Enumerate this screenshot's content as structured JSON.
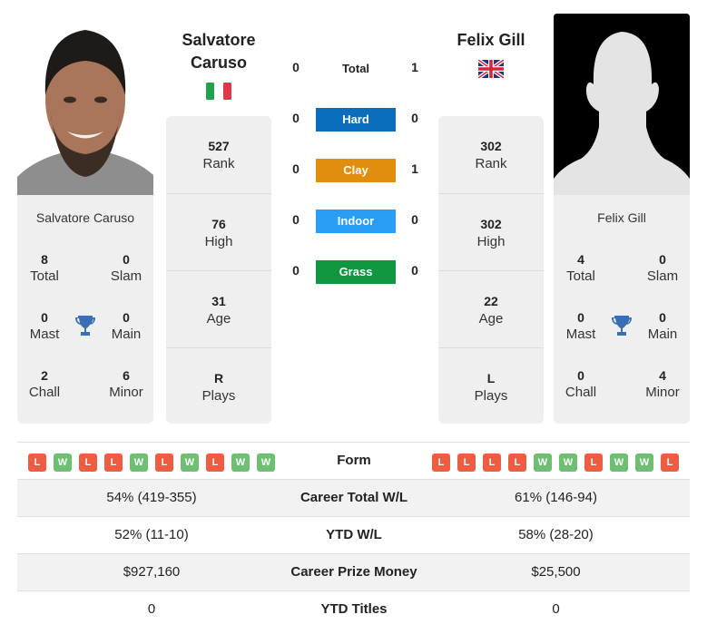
{
  "player1": {
    "name": "Salvatore Caruso",
    "name_line1": "Salvatore",
    "name_line2": "Caruso",
    "flag": "italy-flag",
    "card_name": "Salvatore Caruso",
    "titles": {
      "total": {
        "value": "8",
        "label": "Total"
      },
      "slam": {
        "value": "0",
        "label": "Slam"
      },
      "mast": {
        "value": "0",
        "label": "Mast"
      },
      "main": {
        "value": "0",
        "label": "Main"
      },
      "chall": {
        "value": "2",
        "label": "Chall"
      },
      "minor": {
        "value": "6",
        "label": "Minor"
      }
    },
    "info": [
      {
        "value": "527",
        "label": "Rank"
      },
      {
        "value": "76",
        "label": "High"
      },
      {
        "value": "31",
        "label": "Age"
      },
      {
        "value": "R",
        "label": "Plays"
      }
    ],
    "form": [
      "L",
      "W",
      "L",
      "L",
      "W",
      "L",
      "W",
      "L",
      "W",
      "W"
    ]
  },
  "player2": {
    "name": "Felix Gill",
    "flag": "uk-flag",
    "card_name": "Felix Gill",
    "titles": {
      "total": {
        "value": "4",
        "label": "Total"
      },
      "slam": {
        "value": "0",
        "label": "Slam"
      },
      "mast": {
        "value": "0",
        "label": "Mast"
      },
      "main": {
        "value": "0",
        "label": "Main"
      },
      "chall": {
        "value": "0",
        "label": "Chall"
      },
      "minor": {
        "value": "4",
        "label": "Minor"
      }
    },
    "info": [
      {
        "value": "302",
        "label": "Rank"
      },
      {
        "value": "302",
        "label": "High"
      },
      {
        "value": "22",
        "label": "Age"
      },
      {
        "value": "L",
        "label": "Plays"
      }
    ],
    "form": [
      "L",
      "L",
      "L",
      "L",
      "W",
      "W",
      "L",
      "W",
      "W",
      "L"
    ]
  },
  "h2h": {
    "total": {
      "label": "Total",
      "p1": "0",
      "p2": "1"
    },
    "surfaces": [
      {
        "label": "Hard",
        "p1": "0",
        "p2": "0",
        "color": "#0a6ebd"
      },
      {
        "label": "Clay",
        "p1": "0",
        "p2": "1",
        "color": "#e08e0b"
      },
      {
        "label": "Indoor",
        "p1": "0",
        "p2": "0",
        "color": "#2a9df4"
      },
      {
        "label": "Grass",
        "p1": "0",
        "p2": "0",
        "color": "#0f9640"
      }
    ]
  },
  "comparison": {
    "form_label": "Form",
    "rows": [
      {
        "label": "Career Total W/L",
        "p1": "54% (419-355)",
        "p2": "61% (146-94)"
      },
      {
        "label": "YTD W/L",
        "p1": "52% (11-10)",
        "p2": "58% (28-20)"
      },
      {
        "label": "Career Prize Money",
        "p1": "$927,160",
        "p2": "$25,500"
      },
      {
        "label": "YTD Titles",
        "p1": "0",
        "p2": "0"
      }
    ]
  },
  "colors": {
    "loss": "#ee5c42",
    "win": "#6fbf73",
    "trophy": "#3a6fb5"
  }
}
